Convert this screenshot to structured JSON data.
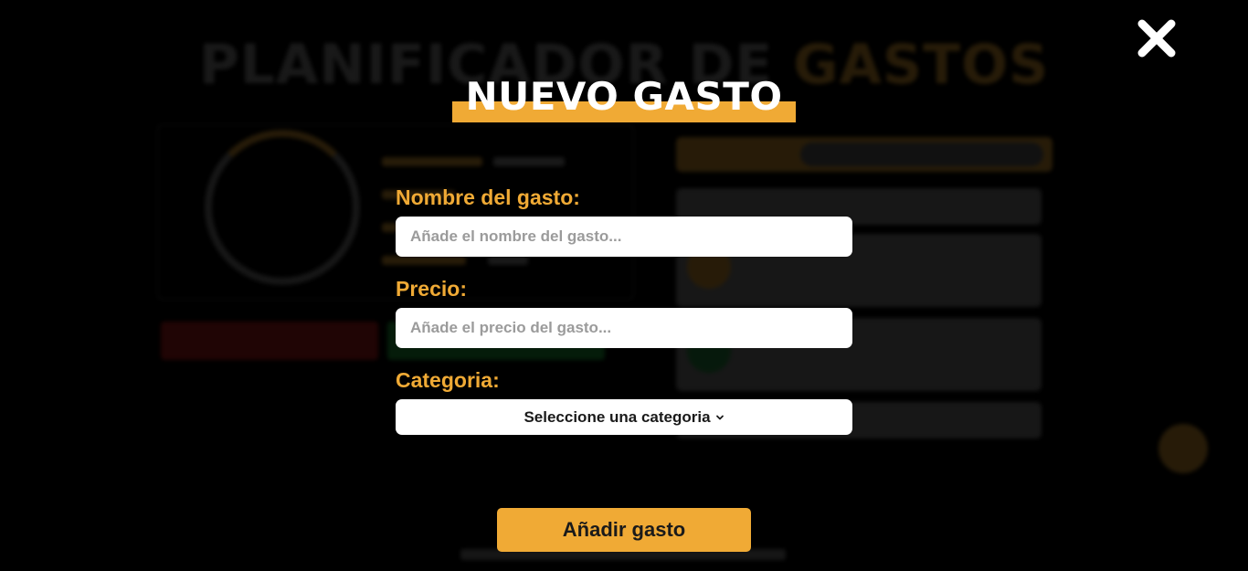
{
  "background_app": {
    "title_part1": "PLANIFICADOR DE ",
    "title_part2": "GASTOS"
  },
  "modal": {
    "title": "NUEVO GASTO",
    "close_icon": "close-icon",
    "fields": {
      "name": {
        "label": "Nombre del gasto:",
        "placeholder": "Añade el nombre del gasto...",
        "value": ""
      },
      "price": {
        "label": "Precio:",
        "placeholder": "Añade el precio del gasto...",
        "value": ""
      },
      "category": {
        "label": "Categoria:",
        "selected": "Seleccione una categoria",
        "icon": "chevron-down-icon"
      }
    },
    "submit_label": "Añadir gasto"
  },
  "colors": {
    "accent": "#f0aa35",
    "overlay": "#000000",
    "input_bg": "#ffffff",
    "label": "#f0aa35"
  }
}
